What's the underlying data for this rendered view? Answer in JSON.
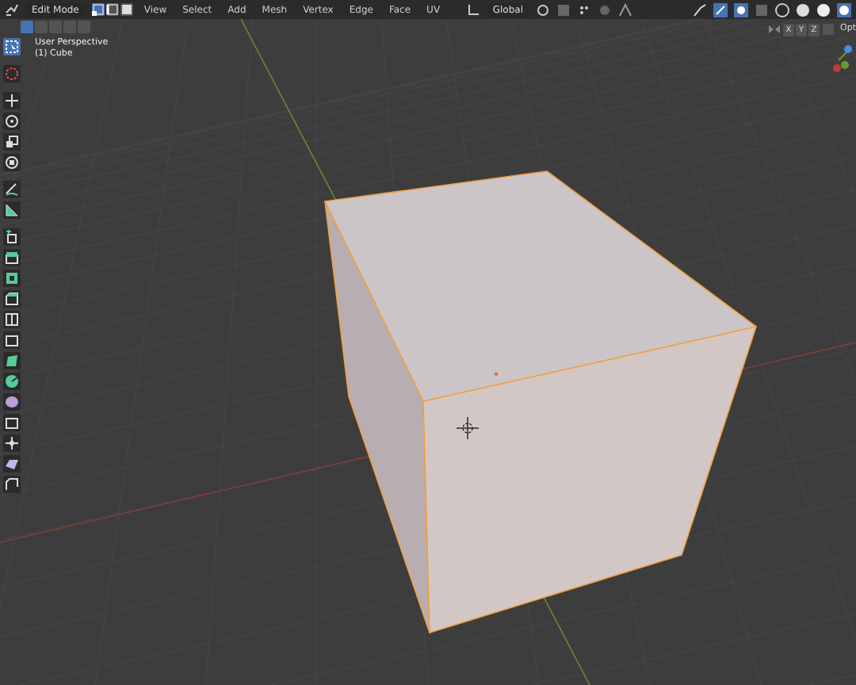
{
  "header": {
    "mode": "Edit Mode",
    "select_modes": [
      {
        "kind": "vertex",
        "selected": true
      },
      {
        "kind": "edge",
        "selected": false
      },
      {
        "kind": "face",
        "selected": false
      }
    ],
    "menus": [
      "View",
      "Select",
      "Add",
      "Mesh",
      "Vertex",
      "Edge",
      "Face",
      "UV"
    ],
    "orientation": "Global"
  },
  "overlay_text": [
    "User Perspective",
    "(1) Cube"
  ],
  "mirror_axes": [
    {
      "label": "X",
      "on": false
    },
    {
      "label": "Y",
      "on": false
    },
    {
      "label": "Z",
      "on": false
    }
  ],
  "options_label": "Opt",
  "toolbar": [
    {
      "kind": "select",
      "selected": true
    },
    {
      "kind": "cursor",
      "selected": false
    },
    {
      "kind": "move",
      "selected": false
    },
    {
      "kind": "rotate",
      "selected": false
    },
    {
      "kind": "scale",
      "selected": false
    },
    {
      "kind": "transform",
      "selected": false
    },
    {
      "kind": "annotate",
      "selected": false
    },
    {
      "kind": "measure",
      "selected": false
    },
    {
      "kind": "add",
      "selected": false
    },
    {
      "kind": "extrude",
      "selected": false
    },
    {
      "kind": "inset",
      "selected": false
    },
    {
      "kind": "bevel",
      "selected": false
    },
    {
      "kind": "loopcut",
      "selected": false
    },
    {
      "kind": "knife",
      "selected": false
    },
    {
      "kind": "polybuild",
      "selected": false
    },
    {
      "kind": "spin",
      "selected": false
    },
    {
      "kind": "smooth",
      "selected": false
    },
    {
      "kind": "slide",
      "selected": false
    },
    {
      "kind": "shrink",
      "selected": false
    },
    {
      "kind": "shear",
      "selected": false
    },
    {
      "kind": "rip",
      "selected": false
    }
  ]
}
